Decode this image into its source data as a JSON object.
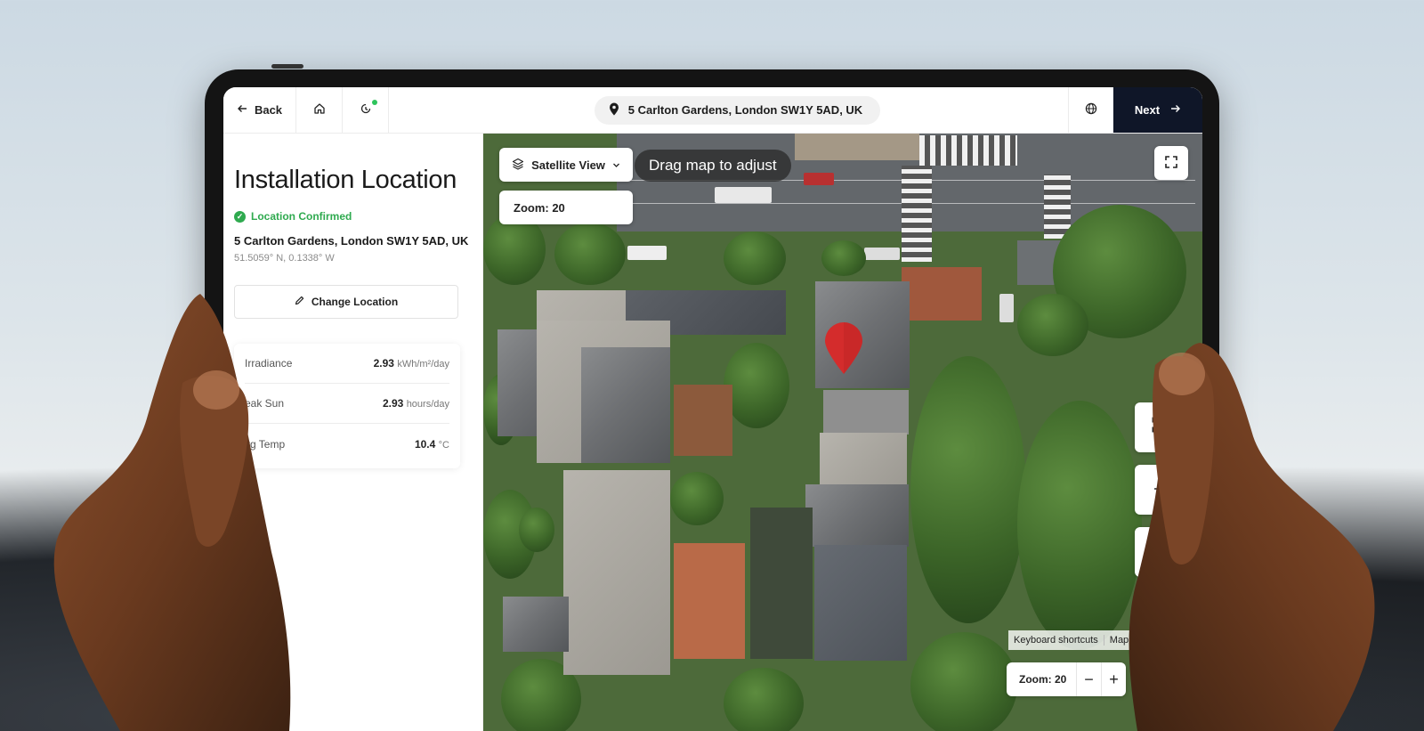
{
  "topbar": {
    "back_label": "Back",
    "address": "5 Carlton Gardens, London SW1Y 5AD, UK",
    "next_label": "Next"
  },
  "panel": {
    "title": "Installation Location",
    "status": "Location Confirmed",
    "address": "5 Carlton Gardens, London SW1Y 5AD, UK",
    "coordinates": "51.5059° N, 0.1338° W",
    "change_label": "Change Location",
    "stats": [
      {
        "label": "Irradiance",
        "value": "2.93",
        "unit": "kWh/m²/day"
      },
      {
        "label": "eak Sun",
        "value": "2.93",
        "unit": "hours/day"
      },
      {
        "label": "vg Temp",
        "value": "10.4",
        "unit": "°C"
      }
    ]
  },
  "map": {
    "view_label": "Satellite View",
    "zoom_label": "Zoom: 20",
    "hint": "Drag map to adjust",
    "attribution": [
      "Keyboard shortcuts",
      "Map Da"
    ],
    "bottom_zoom_label": "Zoom: 20",
    "pin_color": "#d42c2c"
  },
  "colors": {
    "next_bg": "#0f1628",
    "confirmed": "#2faa4f"
  }
}
